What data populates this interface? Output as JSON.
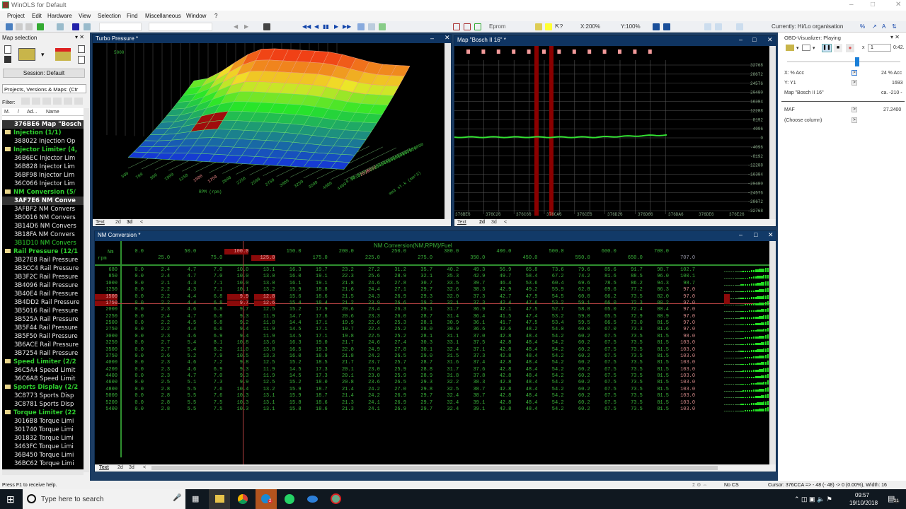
{
  "app": {
    "title": "WinOLS for Default"
  },
  "menu": [
    "Project",
    "Edit",
    "Hardware",
    "View",
    "Selection",
    "Find",
    "Miscellaneous",
    "Window",
    "?"
  ],
  "toolbar": {
    "eprom": "Eprom",
    "xzoom": "X:200%",
    "yzoom": "Y:100%",
    "organisation": "Currently: Hi/Lo organisation"
  },
  "left_panel": {
    "title": "Map selection",
    "session": "Session: Default",
    "dropdown": "Projects, Versions & Maps: (Ctr",
    "filter_label": "Filter:",
    "columns": [
      "M.",
      "/",
      "Ad...",
      "Name"
    ],
    "items": [
      {
        "type": "item",
        "text": "376BE6 Map \"Bosch",
        "sel": true
      },
      {
        "type": "folder",
        "text": "Injection (1/1)"
      },
      {
        "type": "item",
        "text": "388022  Injection Op"
      },
      {
        "type": "folder",
        "text": "Injector Limiter (4,"
      },
      {
        "type": "item",
        "text": "36B6EC  Injector Lim"
      },
      {
        "type": "item",
        "text": "36B828  Injector Lim"
      },
      {
        "type": "item",
        "text": "36BF98  Injector Lim"
      },
      {
        "type": "item",
        "text": "36C066  Injector Lim"
      },
      {
        "type": "folder",
        "text": "NM Conversion (5/"
      },
      {
        "type": "item",
        "text": "3AF7E6 NM Conve",
        "sel": true
      },
      {
        "type": "item",
        "text": "3AFBF2  NM Convers"
      },
      {
        "type": "item",
        "text": "3B0016  NM Convers"
      },
      {
        "type": "item",
        "text": "3B14D6  NM Convers"
      },
      {
        "type": "item",
        "text": "3B18FA  NM Convers"
      },
      {
        "type": "item",
        "text": "3B1D10  NM Convers",
        "green": true
      },
      {
        "type": "folder",
        "text": "Rail Pressure (12/1"
      },
      {
        "type": "item",
        "text": "3B27E8  Rail Pressure"
      },
      {
        "type": "item",
        "text": "3B3CC4  Rail Pressure"
      },
      {
        "type": "item",
        "text": "3B3F2C  Rail Pressure"
      },
      {
        "type": "item",
        "text": "3B4096  Rail Pressure"
      },
      {
        "type": "item",
        "text": "3B40E4  Rail Pressure"
      },
      {
        "type": "item",
        "text": "3B4DD2  Rail Pressure"
      },
      {
        "type": "item",
        "text": "3B5016  Rail Pressure"
      },
      {
        "type": "item",
        "text": "3B525A  Rail Pressure"
      },
      {
        "type": "item",
        "text": "3B5F44  Rail Pressure"
      },
      {
        "type": "item",
        "text": "3B5F50  Rail Pressure"
      },
      {
        "type": "item",
        "text": "3B6ACE  Rail Pressure"
      },
      {
        "type": "item",
        "text": "3B7254  Rail Pressure"
      },
      {
        "type": "folder",
        "text": "Speed Limiter (2/2"
      },
      {
        "type": "item",
        "text": "36C5A4  Speed Limit"
      },
      {
        "type": "item",
        "text": "36C6A8  Speed Limit"
      },
      {
        "type": "folder",
        "text": "Sports Display (2/2"
      },
      {
        "type": "item",
        "text": "3C8773  Sports Disp"
      },
      {
        "type": "item",
        "text": "3C8781  Sports Disp"
      },
      {
        "type": "folder",
        "text": "Torque Limiter (22"
      },
      {
        "type": "item",
        "text": "3016B8  Torque Limi"
      },
      {
        "type": "item",
        "text": "301740  Torque Limi"
      },
      {
        "type": "item",
        "text": "301832  Torque Limi"
      },
      {
        "type": "item",
        "text": "3463FC  Torque Limi"
      },
      {
        "type": "item",
        "text": "36B450  Torque Limi"
      },
      {
        "type": "item",
        "text": "36BC62  Torque Limi"
      }
    ]
  },
  "tabs": {
    "text": "Text",
    "d2": "2d",
    "d3": "3d"
  },
  "turbo": {
    "title": "Turbo Pressure *",
    "zmax": "5000",
    "rpm_label": "RPM (rpm)",
    "load_label": "mm3 st.k (mm^3)",
    "rpm_ticks": [
      "500",
      "700",
      "800",
      "1000",
      "1250",
      "1500",
      "1750",
      "2000",
      "2250",
      "2500",
      "2750",
      "3000",
      "3250",
      "3500",
      "4000",
      "4400"
    ],
    "load_ticks": [
      "0.00",
      "10.00",
      "15.00",
      "20.00",
      "25.00",
      "30.00",
      "35.00",
      "40.00",
      "45.00",
      "50.00",
      "55.00",
      "60.00",
      "65.00",
      "70.00",
      "75.00"
    ]
  },
  "bosch": {
    "title": "Map \"Bosch II 16\" *",
    "y_labels": [
      "32768",
      "28672",
      "24576",
      "20480",
      "16384",
      "12288",
      "8192",
      "4096",
      "0",
      "-4096",
      "-8192",
      "-12288",
      "-16384",
      "-20480",
      "-24576",
      "-28672",
      "-32768"
    ],
    "x_labels": [
      "376BE6",
      "376C26",
      "376C66",
      "376CA6",
      "376CE6",
      "376D26",
      "376D66",
      "376DA6",
      "376DE6",
      "376E26"
    ]
  },
  "nm": {
    "title": "NM Conversion *",
    "table_title": "NM Conversion(NM,RPM)/Fuel",
    "x_unit": "Nm",
    "y_unit": "rpm",
    "cols": [
      "0.0",
      "25.0",
      "50.0",
      "75.0",
      "100.0",
      "125.0",
      "150.0",
      "175.0",
      "200.0",
      "225.0",
      "250.0",
      "275.0",
      "300.0",
      "350.0",
      "400.0",
      "450.0",
      "500.0",
      "550.0",
      "600.0",
      "650.0",
      "700.0",
      "707.0"
    ],
    "rows": [
      "680",
      "850",
      "1000",
      "1250",
      "1500",
      "1750",
      "2000",
      "2250",
      "2500",
      "2750",
      "3000",
      "3250",
      "3500",
      "3750",
      "4000",
      "4200",
      "4400",
      "4600",
      "4800",
      "5000",
      "5200",
      "5400"
    ],
    "values": [
      [
        "0.0",
        "2.4",
        "4.7",
        "7.0",
        "10.0",
        "13.1",
        "16.3",
        "19.7",
        "23.2",
        "27.2",
        "31.2",
        "35.7",
        "40.2",
        "49.3",
        "56.9",
        "65.8",
        "73.6",
        "79.6",
        "85.6",
        "91.7",
        "98.7",
        "102.7"
      ],
      [
        "0.0",
        "2.4",
        "4.7",
        "7.0",
        "10.0",
        "13.0",
        "16.0",
        "19.1",
        "22.3",
        "25.6",
        "28.9",
        "32.1",
        "35.3",
        "42.9",
        "49.7",
        "58.4",
        "67.2",
        "74.2",
        "81.6",
        "88.5",
        "96.0",
        "100.1"
      ],
      [
        "0.0",
        "2.1",
        "4.3",
        "7.1",
        "10.0",
        "13.0",
        "16.1",
        "19.1",
        "21.8",
        "24.6",
        "27.8",
        "30.7",
        "33.5",
        "39.7",
        "46.4",
        "53.6",
        "60.4",
        "69.6",
        "78.5",
        "86.2",
        "94.3",
        "98.7"
      ],
      [
        "0.0",
        "2.2",
        "4.3",
        "7.1",
        "10.1",
        "13.2",
        "15.9",
        "18.8",
        "21.6",
        "24.4",
        "27.1",
        "29.7",
        "32.6",
        "38.3",
        "42.9",
        "49.2",
        "55.9",
        "62.8",
        "69.6",
        "77.2",
        "86.3",
        "97.0"
      ],
      [
        "0.0",
        "2.2",
        "4.4",
        "6.8",
        "9.9",
        "12.8",
        "15.6",
        "18.6",
        "21.5",
        "24.3",
        "26.9",
        "29.3",
        "32.0",
        "37.3",
        "42.7",
        "47.9",
        "54.5",
        "60.0",
        "66.2",
        "73.5",
        "82.0",
        "97.0"
      ],
      [
        "0.0",
        "2.2",
        "4.4",
        "6.8",
        "9.7",
        "12.6",
        "15.4",
        "18.4",
        "21.2",
        "23.9",
        "26.6",
        "29.2",
        "32.1",
        "37.3",
        "42.4",
        "47.6",
        "53.2",
        "59.1",
        "66.0",
        "72.3",
        "80.2",
        "97.0"
      ],
      [
        "0.0",
        "2.3",
        "4.6",
        "6.8",
        "9.7",
        "12.5",
        "15.2",
        "17.9",
        "20.6",
        "23.4",
        "26.3",
        "29.1",
        "31.7",
        "36.9",
        "42.1",
        "47.5",
        "52.7",
        "58.8",
        "65.0",
        "72.4",
        "80.4",
        "97.0"
      ],
      [
        "0.0",
        "2.4",
        "4.7",
        "6.8",
        "9.3",
        "11.9",
        "14.7",
        "17.6",
        "20.6",
        "23.3",
        "26.0",
        "28.7",
        "31.4",
        "36.4",
        "41.5",
        "47.4",
        "53.2",
        "59.0",
        "65.5",
        "72.9",
        "80.9",
        "97.0"
      ],
      [
        "0.0",
        "2.2",
        "4.5",
        "6.8",
        "9.2",
        "11.8",
        "14.4",
        "17.1",
        "19.9",
        "22.6",
        "25.3",
        "28.1",
        "30.9",
        "36.1",
        "41.7",
        "47.5",
        "53.4",
        "59.5",
        "66.5",
        "73.0",
        "81.5",
        "97.0"
      ],
      [
        "0.0",
        "2.2",
        "4.4",
        "6.6",
        "9.4",
        "11.9",
        "14.5",
        "17.1",
        "19.7",
        "22.4",
        "25.2",
        "28.0",
        "30.9",
        "36.6",
        "42.6",
        "48.2",
        "54.0",
        "60.0",
        "67.0",
        "73.3",
        "81.6",
        "97.0"
      ],
      [
        "0.0",
        "2.3",
        "4.6",
        "6.9",
        "9.4",
        "11.9",
        "14.5",
        "17.1",
        "19.8",
        "22.5",
        "25.2",
        "28.1",
        "31.1",
        "37.0",
        "42.8",
        "48.4",
        "54.2",
        "60.2",
        "67.5",
        "73.5",
        "81.5",
        "98.0"
      ],
      [
        "0.0",
        "2.7",
        "5.4",
        "8.1",
        "10.8",
        "13.6",
        "16.3",
        "19.0",
        "21.7",
        "24.6",
        "27.4",
        "30.3",
        "33.1",
        "37.5",
        "42.8",
        "48.4",
        "54.2",
        "60.2",
        "67.5",
        "73.5",
        "81.5",
        "103.0"
      ],
      [
        "0.0",
        "2.7",
        "5.4",
        "8.2",
        "11.0",
        "13.8",
        "16.5",
        "19.3",
        "22.0",
        "24.9",
        "27.8",
        "30.1",
        "32.4",
        "37.1",
        "42.8",
        "48.4",
        "54.2",
        "60.2",
        "67.5",
        "73.5",
        "81.5",
        "103.0"
      ],
      [
        "0.0",
        "2.6",
        "5.2",
        "7.9",
        "10.5",
        "13.3",
        "16.0",
        "18.9",
        "21.8",
        "24.2",
        "26.5",
        "29.0",
        "31.5",
        "37.3",
        "42.8",
        "48.4",
        "54.2",
        "60.2",
        "67.5",
        "73.5",
        "81.5",
        "103.0"
      ],
      [
        "0.0",
        "2.3",
        "4.6",
        "7.2",
        "9.8",
        "12.5",
        "15.2",
        "18.5",
        "21.7",
        "23.7",
        "25.7",
        "28.7",
        "31.6",
        "37.4",
        "42.8",
        "48.4",
        "54.2",
        "60.2",
        "67.5",
        "73.5",
        "81.5",
        "103.0"
      ],
      [
        "0.0",
        "2.3",
        "4.6",
        "6.9",
        "9.3",
        "11.9",
        "14.5",
        "17.3",
        "20.1",
        "23.0",
        "25.9",
        "28.8",
        "31.7",
        "37.6",
        "42.8",
        "48.4",
        "54.2",
        "60.2",
        "67.5",
        "73.5",
        "81.5",
        "103.0"
      ],
      [
        "0.0",
        "2.3",
        "4.7",
        "7.0",
        "9.3",
        "11.9",
        "14.5",
        "17.3",
        "20.1",
        "23.0",
        "25.9",
        "28.9",
        "31.8",
        "37.8",
        "42.8",
        "48.4",
        "54.2",
        "60.2",
        "67.5",
        "73.5",
        "81.5",
        "103.0"
      ],
      [
        "0.0",
        "2.5",
        "5.1",
        "7.3",
        "9.9",
        "12.5",
        "15.2",
        "18.0",
        "20.8",
        "23.6",
        "26.5",
        "29.3",
        "32.2",
        "38.3",
        "42.8",
        "48.4",
        "54.2",
        "60.2",
        "67.5",
        "73.5",
        "81.5",
        "103.0"
      ],
      [
        "0.0",
        "2.8",
        "5.5",
        "7.6",
        "10.4",
        "13.2",
        "15.9",
        "18.7",
        "21.4",
        "24.2",
        "27.0",
        "29.8",
        "32.5",
        "38.7",
        "42.8",
        "48.4",
        "54.2",
        "60.2",
        "67.5",
        "73.5",
        "81.5",
        "103.0"
      ],
      [
        "0.0",
        "2.8",
        "5.5",
        "7.6",
        "10.3",
        "13.1",
        "15.9",
        "18.7",
        "21.4",
        "24.2",
        "26.9",
        "29.7",
        "32.4",
        "38.7",
        "42.8",
        "48.4",
        "54.2",
        "60.2",
        "67.5",
        "73.5",
        "81.5",
        "103.0"
      ],
      [
        "0.0",
        "2.8",
        "5.5",
        "7.5",
        "10.3",
        "13.1",
        "15.8",
        "18.6",
        "21.3",
        "24.1",
        "26.9",
        "29.7",
        "32.4",
        "39.1",
        "42.8",
        "48.4",
        "54.2",
        "60.2",
        "67.5",
        "73.5",
        "81.5",
        "103.0"
      ],
      [
        "0.0",
        "2.8",
        "5.5",
        "7.5",
        "10.3",
        "13.1",
        "15.8",
        "18.6",
        "21.3",
        "24.1",
        "26.9",
        "29.7",
        "32.4",
        "39.1",
        "42.8",
        "48.4",
        "54.2",
        "60.2",
        "67.5",
        "73.5",
        "81.5",
        "103.0"
      ]
    ],
    "highlight_rows": [
      4,
      5
    ],
    "highlight_cols": [
      4,
      5
    ]
  },
  "obd": {
    "title": "OBD-Visualizer: Playing",
    "speed": "1",
    "time": "0:42.",
    "x_label": "X: % Acc",
    "x_value": "24 % Acc",
    "y_label": "Y: Y1",
    "y_value": "1693",
    "map_label": "Map \"Bosch II 16\"",
    "map_value": "ca. -210 -",
    "maf_label": "MAF",
    "maf_value": "27.2400",
    "choose": "(Choose column)",
    "slider_value": 0.62
  },
  "status": {
    "help": "Press F1 to receive help.",
    "cs": "No CS",
    "cursor": "Cursor: 376CCA => -  48 (-  48) ->    0 (0.00%), Width: 16"
  },
  "taskbar": {
    "search": "Type here to search",
    "time": "09:57",
    "date": "19/10/2018",
    "notif": "21",
    "skype_badge": "2"
  },
  "colors": {
    "accent": "#0f3461",
    "grid_green": "#3bb33b",
    "highlight": "#8b0a0a"
  }
}
